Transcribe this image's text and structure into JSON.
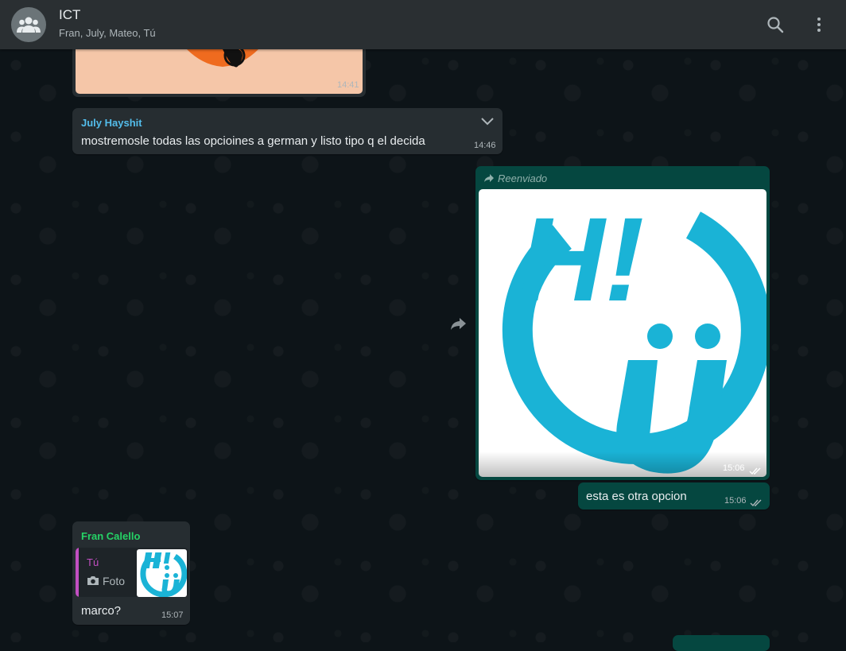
{
  "header": {
    "title": "ICT",
    "subtitle": "Fran, July, Mateo, Tú"
  },
  "messages": {
    "top_image": {
      "time": "14:41"
    },
    "july": {
      "sender": "July Hayshit",
      "text": "mostremosle todas las opcioines a german y listo tipo q el decida",
      "time": "14:46"
    },
    "forwarded": {
      "label": "Reenviado",
      "image_time": "15:06",
      "image_text": "H!",
      "text": "esta es otra opcion",
      "time": "15:06"
    },
    "fran": {
      "sender": "Fran Calello",
      "quote_author": "Tú",
      "quote_label": "Foto",
      "text": "marco?",
      "time": "15:07"
    }
  },
  "colors": {
    "july_name": "#53bdeb",
    "fran_name": "#25d366",
    "quote_author": "#c24fc2",
    "accent_cyan": "#1ab3d6"
  },
  "icons": [
    "group-avatar-icon",
    "search-icon",
    "menu-icon",
    "chevron-down-icon",
    "forward-icon",
    "camera-icon",
    "double-check-icon"
  ]
}
